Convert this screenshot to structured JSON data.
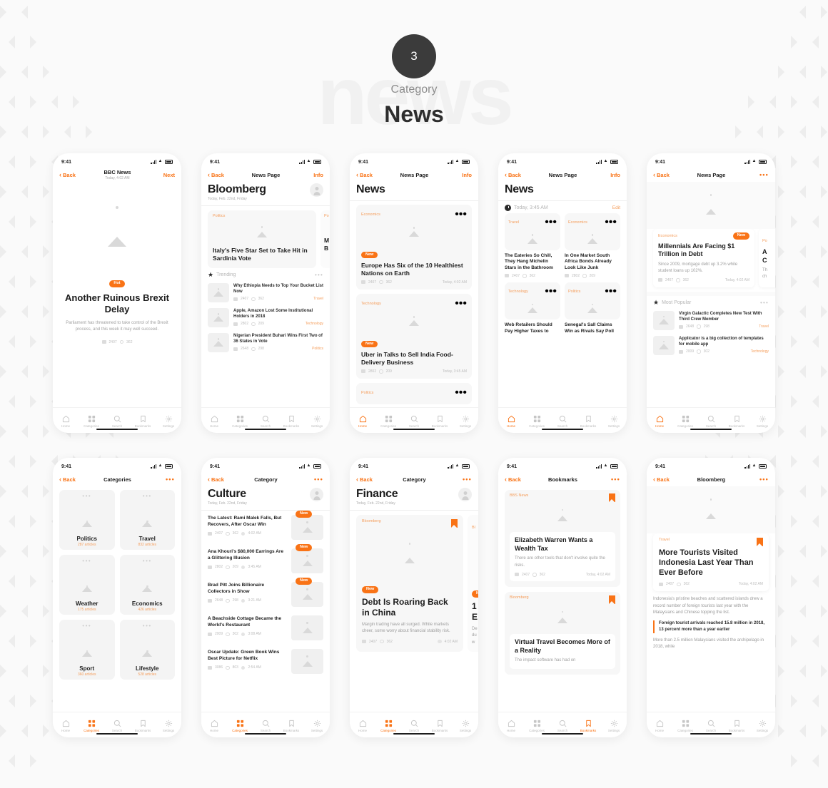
{
  "header": {
    "number": "3",
    "watermark": "news",
    "label": "Category",
    "title": "News"
  },
  "accent": "#f97316",
  "status": {
    "time": "9:41"
  },
  "tabs": [
    {
      "name": "home",
      "label": "Home"
    },
    {
      "name": "categories",
      "label": "Categories"
    },
    {
      "name": "search",
      "label": "Search"
    },
    {
      "name": "bookmarks",
      "label": "Bookmarks"
    },
    {
      "name": "settings",
      "label": "Settings"
    }
  ],
  "common": {
    "back": "Back",
    "next": "Next",
    "info": "Info",
    "edit": "Edit",
    "new": "New",
    "hot": "Hot",
    "dots": "•••"
  },
  "screens": [
    {
      "id": "article-brexit",
      "nav": {
        "title": "BBC News",
        "subtitle": "Today, 4:02 AM",
        "left": "Back",
        "right": "Next"
      },
      "badge": "Hot",
      "headline": "Another Ruinous Brexit Delay",
      "body": "Parliament has threatened to take control of the Brexit process, and this week it may well succeed.",
      "comments": "2407",
      "views": "362",
      "active_tab": "none"
    },
    {
      "id": "bloomberg-feed",
      "nav": {
        "title": "News Page",
        "left": "Back",
        "right": "Info"
      },
      "page_title": "Bloomberg",
      "page_date": "Today, Feb. 22nd, Friday",
      "hero": {
        "tag": "Politics",
        "title": "Italy's Five Star Set to Take Hit in Sardinia Vote"
      },
      "hero_partial": {
        "tag": "Po",
        "line1": "M",
        "line2": "B"
      },
      "section": {
        "title": "Trending"
      },
      "list": [
        {
          "title": "Why Ethiopia Needs to Top Your Bucket List Now",
          "comments": "2407",
          "views": "362",
          "tag": "Travel"
        },
        {
          "title": "Apple, Amazon Lost Some Institutional Holders in 2018",
          "comments": "2802",
          "views": "209",
          "tag": "Technology"
        },
        {
          "title": "Nigerian President Buhari Wins First Two of 36 States in Vote",
          "comments": "2648",
          "views": "298",
          "tag": "Politics"
        }
      ],
      "active_tab": "none"
    },
    {
      "id": "news-cards",
      "nav": {
        "title": "News Page",
        "left": "Back",
        "right": "Info"
      },
      "page_title": "News",
      "cards": [
        {
          "tag": "Economics",
          "badge": "New",
          "title": "Europe Has Six of the 10 Healthiest Nations on Earth",
          "comments": "2407",
          "views": "362",
          "time": "Today, 4:02 AM"
        },
        {
          "tag": "Technology",
          "badge": "New",
          "title": "Uber in Talks to Sell India Food-Delivery Business",
          "comments": "2802",
          "views": "209",
          "time": "Today, 3:45 AM"
        },
        {
          "tag": "Politics",
          "badge": "",
          "title": "",
          "comments": "",
          "views": "",
          "time": ""
        }
      ],
      "active_tab": "home"
    },
    {
      "id": "news-grid",
      "nav": {
        "title": "News Page",
        "left": "Back",
        "right": "Info"
      },
      "page_title": "News",
      "section": {
        "title": "Today, 3:45 AM",
        "action": "Edit"
      },
      "grid": [
        {
          "tag": "Travel",
          "title": "The Eateries So Chill, They Hang Michelin Stars in the Bathroom",
          "comments": "2407",
          "views": "362"
        },
        {
          "tag": "Economics",
          "title": "In One Market South Africa Bonds Already Look Like Junk",
          "comments": "2802",
          "views": "209"
        },
        {
          "tag": "Technology",
          "title": "Web Retailers Should Pay Higher Taxes to",
          "comments": "",
          "views": ""
        },
        {
          "tag": "Politics",
          "title": "Senegal's Sall Claims Win as Rivals Say Poll",
          "comments": "",
          "views": ""
        }
      ],
      "active_tab": "home"
    },
    {
      "id": "news-popular",
      "nav": {
        "title": "News Page",
        "left": "Back",
        "right": "dots"
      },
      "hero_card": {
        "tag": "Economics",
        "badge": "New",
        "title": "Millennials Are Facing $1 Trillion in Debt",
        "body": "Since 2009, mortgage debt up 3.2% while student loans up 102%.",
        "comments": "2407",
        "views": "362",
        "time": "Today, 4:02 AM"
      },
      "hero_partial": {
        "tag": "Po",
        "line1": "A",
        "line2": "C",
        "body1": "Th",
        "body2": "ch"
      },
      "section": {
        "title": "Most Popular"
      },
      "list": [
        {
          "title": "Virgin Galactic Completes New Test With Third Crew Member",
          "comments": "2648",
          "views": "298",
          "tag": "Travel"
        },
        {
          "title": "Applicator is a big collection of templates for mobile app",
          "comments": "2009",
          "views": "302",
          "tag": "Technology"
        }
      ],
      "active_tab": "home"
    },
    {
      "id": "categories",
      "nav": {
        "title": "Categories",
        "left": "Back",
        "right": "dots"
      },
      "categories": [
        {
          "name": "Politics",
          "count": "287 articles"
        },
        {
          "name": "Travel",
          "count": "832 articles"
        },
        {
          "name": "Weather",
          "count": "175 articles"
        },
        {
          "name": "Economics",
          "count": "426 articles"
        },
        {
          "name": "Sport",
          "count": "360 articles"
        },
        {
          "name": "Lifestyle",
          "count": "528 articles"
        }
      ],
      "active_tab": "categories"
    },
    {
      "id": "category-culture",
      "nav": {
        "title": "Category",
        "left": "Back",
        "right": "dots"
      },
      "page_title": "Culture",
      "page_date": "Today, Feb. 22nd, Friday",
      "list": [
        {
          "title": "The Latest: Rami Malek Falls, But Recovers, After Oscar Win",
          "comments": "2407",
          "views": "362",
          "time": "4:02 AM",
          "badge": "New"
        },
        {
          "title": "Ana Khouri's $80,000 Earrings Are a Glittering Illusion",
          "comments": "2802",
          "views": "209",
          "time": "3:45 AM",
          "badge": "New"
        },
        {
          "title": "Brad Pitt Joins Billionaire Collectors in Show",
          "comments": "2648",
          "views": "298",
          "time": "3:21 AM",
          "badge": "New"
        },
        {
          "title": "A Beachside Cottage Became the World's Restaurant",
          "comments": "2009",
          "views": "302",
          "time": "3:08 AM",
          "badge": ""
        },
        {
          "title": "Oscar Update: Green Book Wins Best Picture for Netflix",
          "comments": "3086",
          "views": "803",
          "time": "2:54 AM",
          "badge": ""
        }
      ],
      "active_tab": "categories"
    },
    {
      "id": "category-finance",
      "nav": {
        "title": "Category",
        "left": "Back",
        "right": "dots"
      },
      "page_title": "Finance",
      "page_date": "Today, Feb. 22nd, Friday",
      "card": {
        "source": "Bloomberg",
        "badge": "New",
        "title": "Debt Is Roaring Back in China",
        "body": "Margin trading have all surged. While markets cheer, some worry about financial stability risk.",
        "comments": "2407",
        "views": "362",
        "time": "4:02 AM"
      },
      "card_partial": {
        "source": "Bl",
        "line1": "1",
        "line2": "E",
        "body1": "De",
        "body2": "du",
        "body3": "w"
      },
      "active_tab": "categories"
    },
    {
      "id": "bookmarks",
      "nav": {
        "title": "Bookmarks",
        "left": "Back",
        "right": "dots"
      },
      "items": [
        {
          "source": "BBS News",
          "title": "Elizabeth Warren Wants a Wealth Tax",
          "body": "There are other tools that don't involve quite the risks.",
          "comments": "2407",
          "views": "362",
          "time": "Today, 4:02 AM"
        },
        {
          "source": "Bloomberg",
          "title": "Virtual Travel Becomes More of a Reality",
          "body": "The impact software has had on",
          "comments": "",
          "views": "",
          "time": ""
        }
      ],
      "active_tab": "bookmarks"
    },
    {
      "id": "article-indonesia",
      "nav": {
        "title": "Bloomberg",
        "left": "Back",
        "right": "dots"
      },
      "card": {
        "tag": "Travel",
        "title": "More Tourists Visited Indonesia Last Year Than Ever Before",
        "comments": "2407",
        "views": "362",
        "time": "Today, 4:02 AM"
      },
      "paragraph1": "Indonesia's pristine beaches and scattered islands drew a record number of foreign tourists last year with the Malaysians and Chinese topping the list.",
      "quote": "Foreign tourist arrivals reached 15.8 million in 2018, 13 percent more than a year earlier",
      "paragraph2": "More than 2.5 million Malaysians visited the archipelago in 2018, while",
      "active_tab": "none"
    }
  ]
}
